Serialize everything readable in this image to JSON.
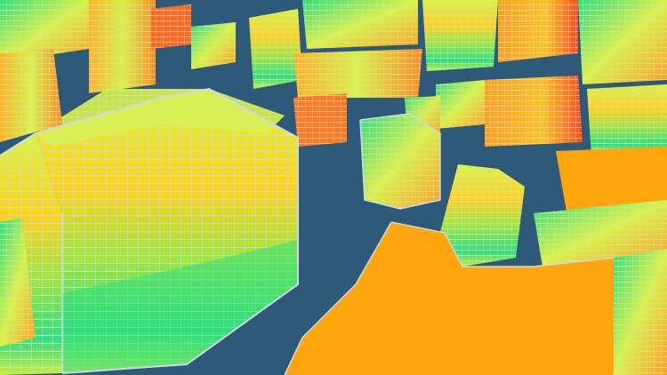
{
  "scene": {
    "description_visible_text": "",
    "palette": {
      "ground": "#2d5a78",
      "wire": "#cfd8e6",
      "low": "#2ee07a",
      "mid": "#d9f53a",
      "high": "#ffa11a",
      "peak": "#ff4a1a",
      "roof_flat": "#ffa60f"
    }
  }
}
